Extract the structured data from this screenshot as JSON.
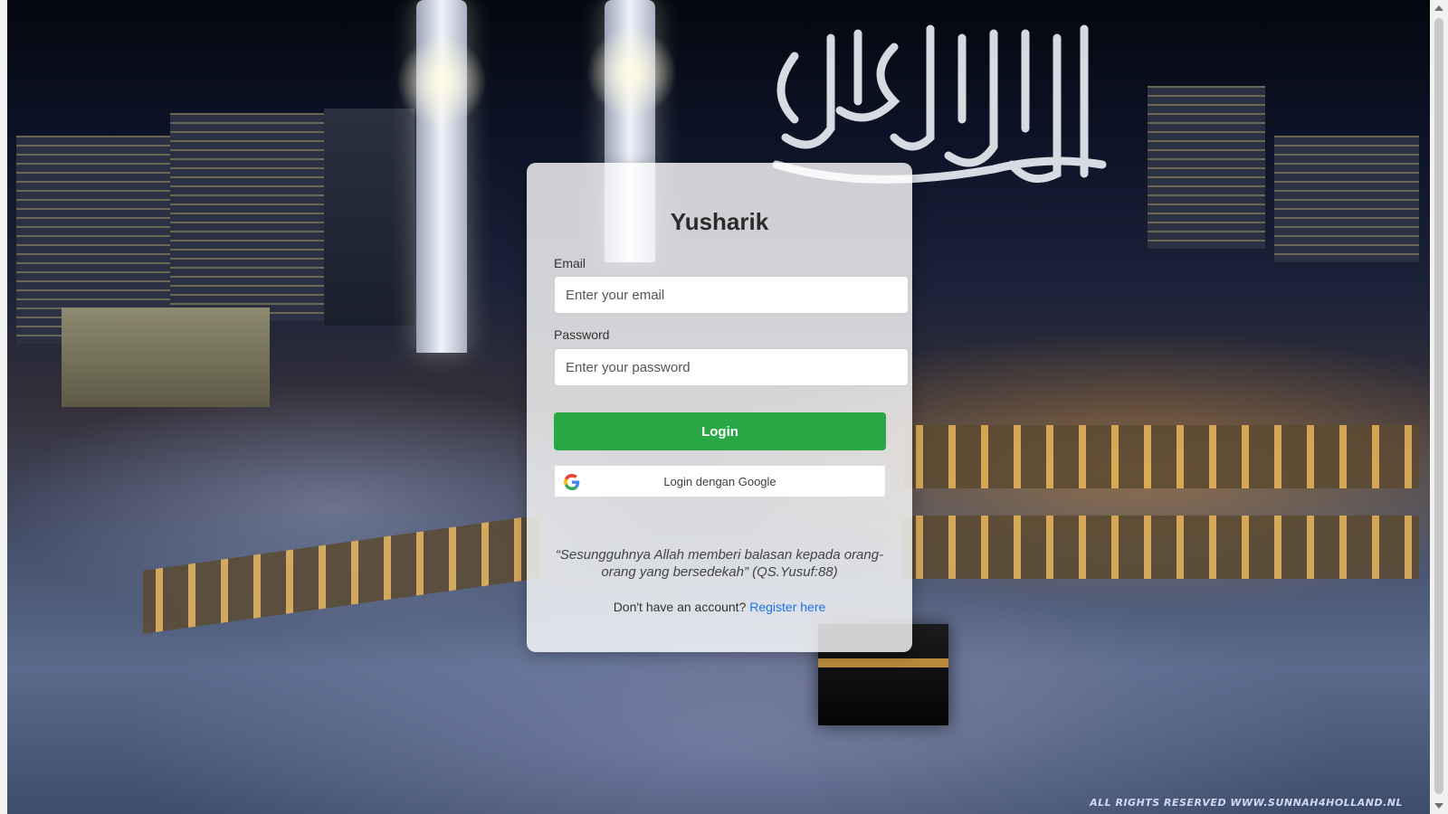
{
  "app": {
    "title": "Yusharik"
  },
  "form": {
    "email_label": "Email",
    "email_placeholder": "Enter your email",
    "email_value": "",
    "password_label": "Password",
    "password_placeholder": "Enter your password",
    "password_value": "",
    "login_label": "Login",
    "google_label": "Login dengan Google"
  },
  "quote": "“Sesungguhnya Allah memberi balasan kepada orang-orang yang bersedekah” (QS.Yusuf:88)",
  "footer": {
    "prompt": "Don't have an account?",
    "register_link": "Register here"
  },
  "background": {
    "watermark": "ALL RIGHTS RESERVED WWW.SUNNAH4HOLLAND.NL"
  },
  "colors": {
    "login_button": "#29a745",
    "link": "#1a73e8",
    "card_bg": "rgba(255,255,255,0.80)"
  },
  "icons": {
    "google": "google-g-icon"
  }
}
